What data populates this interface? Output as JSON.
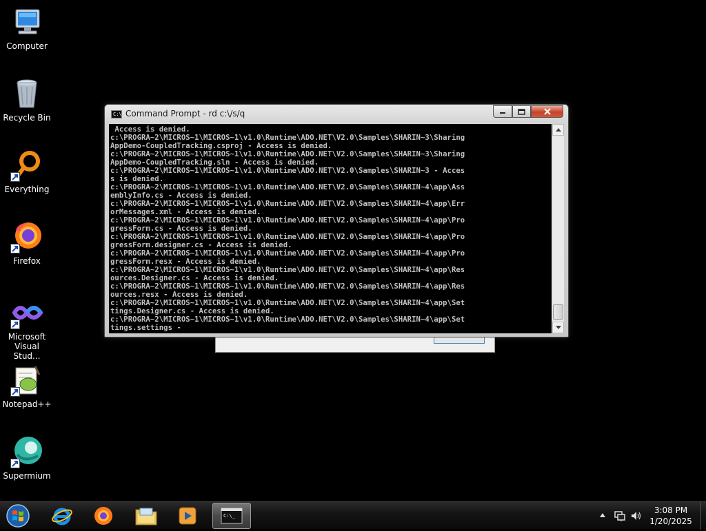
{
  "desktop": {
    "icons": [
      {
        "label": "Computer"
      },
      {
        "label": "Recycle Bin"
      },
      {
        "label": "Everything"
      },
      {
        "label": "Firefox"
      },
      {
        "label": "Microsoft Visual Stud..."
      },
      {
        "label": "Notepad++"
      },
      {
        "label": "Supermium"
      }
    ]
  },
  "cmd": {
    "title": "Command Prompt - rd  c:\\/s/q",
    "icon_text": "C:\\",
    "lines": [
      " Access is denied.",
      "c:\\PROGRA~2\\MICROS~1\\MICROS~1\\v1.0\\Runtime\\ADO.NET\\V2.0\\Samples\\SHARIN~3\\Sharing",
      "AppDemo-CoupledTracking.csproj - Access is denied.",
      "c:\\PROGRA~2\\MICROS~1\\MICROS~1\\v1.0\\Runtime\\ADO.NET\\V2.0\\Samples\\SHARIN~3\\Sharing",
      "AppDemo-CoupledTracking.sln - Access is denied.",
      "c:\\PROGRA~2\\MICROS~1\\MICROS~1\\v1.0\\Runtime\\ADO.NET\\V2.0\\Samples\\SHARIN~3 - Acces",
      "s is denied.",
      "c:\\PROGRA~2\\MICROS~1\\MICROS~1\\v1.0\\Runtime\\ADO.NET\\V2.0\\Samples\\SHARIN~4\\app\\Ass",
      "emblyInfo.cs - Access is denied.",
      "c:\\PROGRA~2\\MICROS~1\\MICROS~1\\v1.0\\Runtime\\ADO.NET\\V2.0\\Samples\\SHARIN~4\\app\\Err",
      "orMessages.xml - Access is denied.",
      "c:\\PROGRA~2\\MICROS~1\\MICROS~1\\v1.0\\Runtime\\ADO.NET\\V2.0\\Samples\\SHARIN~4\\app\\Pro",
      "gressForm.cs - Access is denied.",
      "c:\\PROGRA~2\\MICROS~1\\MICROS~1\\v1.0\\Runtime\\ADO.NET\\V2.0\\Samples\\SHARIN~4\\app\\Pro",
      "gressForm.designer.cs - Access is denied.",
      "c:\\PROGRA~2\\MICROS~1\\MICROS~1\\v1.0\\Runtime\\ADO.NET\\V2.0\\Samples\\SHARIN~4\\app\\Pro",
      "gressForm.resx - Access is denied.",
      "c:\\PROGRA~2\\MICROS~1\\MICROS~1\\v1.0\\Runtime\\ADO.NET\\V2.0\\Samples\\SHARIN~4\\app\\Res",
      "ources.Designer.cs - Access is denied.",
      "c:\\PROGRA~2\\MICROS~1\\MICROS~1\\v1.0\\Runtime\\ADO.NET\\V2.0\\Samples\\SHARIN~4\\app\\Res",
      "ources.resx - Access is denied.",
      "c:\\PROGRA~2\\MICROS~1\\MICROS~1\\v1.0\\Runtime\\ADO.NET\\V2.0\\Samples\\SHARIN~4\\app\\Set",
      "tings.Designer.cs - Access is denied.",
      "c:\\PROGRA~2\\MICROS~1\\MICROS~1\\v1.0\\Runtime\\ADO.NET\\V2.0\\Samples\\SHARIN~4\\app\\Set",
      "tings.settings -"
    ]
  },
  "taskbar": {
    "items": [
      "start-button",
      "internet-explorer",
      "firefox",
      "file-explorer",
      "media-player",
      "command-prompt"
    ],
    "active": "command-prompt",
    "clock_time": "3:08 PM",
    "clock_date": "1/20/2025"
  },
  "colors": {
    "console_bg": "#000000",
    "console_fg": "#c0c0c0",
    "close_red": "#c7432a"
  }
}
